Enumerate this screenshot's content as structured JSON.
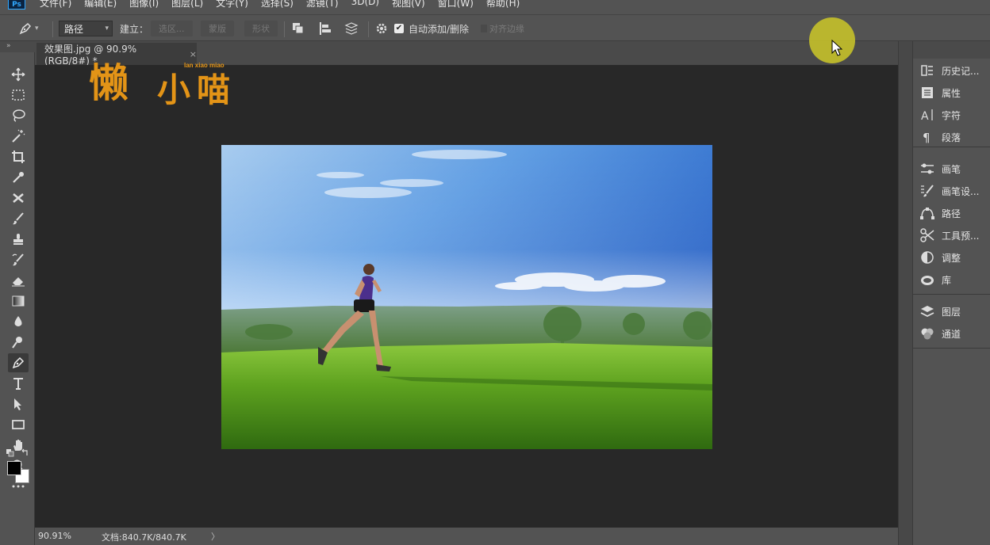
{
  "app": {
    "logo_text": "Ps"
  },
  "menu": [
    "文件(F)",
    "编辑(E)",
    "图像(I)",
    "图层(L)",
    "文字(Y)",
    "选择(S)",
    "滤镜(T)",
    "3D(D)",
    "视图(V)",
    "窗口(W)",
    "帮助(H)"
  ],
  "options_bar": {
    "mode_select": "路径",
    "make_label": "建立：",
    "selection_button": "选区...",
    "mask_button": "蒙版",
    "shape_button": "形状",
    "auto_add_delete_label": "自动添加/删除",
    "auto_add_delete_checked": true,
    "align_edges_label": "对齐边缘"
  },
  "document": {
    "tab_title": "效果图.jpg @ 90.9%(RGB/8#) *",
    "close_glyph": "×"
  },
  "status": {
    "zoom": "90.91%",
    "doc_size": "文档:840.7K/840.7K",
    "arrow": "〉"
  },
  "panels": {
    "group1": [
      "历史记...",
      "属性",
      "字符",
      "段落"
    ],
    "group2": [
      "画笔",
      "画笔设...",
      "路径",
      "工具预...",
      "调整",
      "库"
    ],
    "group3": [
      "图层",
      "通道"
    ]
  },
  "tools": [
    "move-tool",
    "marquee-tool",
    "lasso-tool",
    "magic-wand-tool",
    "crop-tool",
    "eyedropper-tool",
    "healing-brush-tool",
    "brush-tool",
    "clone-stamp-tool",
    "history-brush-tool",
    "eraser-tool",
    "gradient-tool",
    "blur-tool",
    "dodge-tool",
    "pen-tool",
    "type-tool",
    "path-selection-tool",
    "rectangle-tool",
    "hand-tool",
    "zoom-tool",
    "more-tools"
  ],
  "watermark": {
    "chinese": "懒小喵",
    "latin": "lan xiao miao"
  },
  "colors": {
    "foreground": "#000000",
    "background": "#ffffff",
    "accent": "#31a8ff",
    "watermark": "#e39417",
    "cursor_highlight": "#cdc828"
  }
}
